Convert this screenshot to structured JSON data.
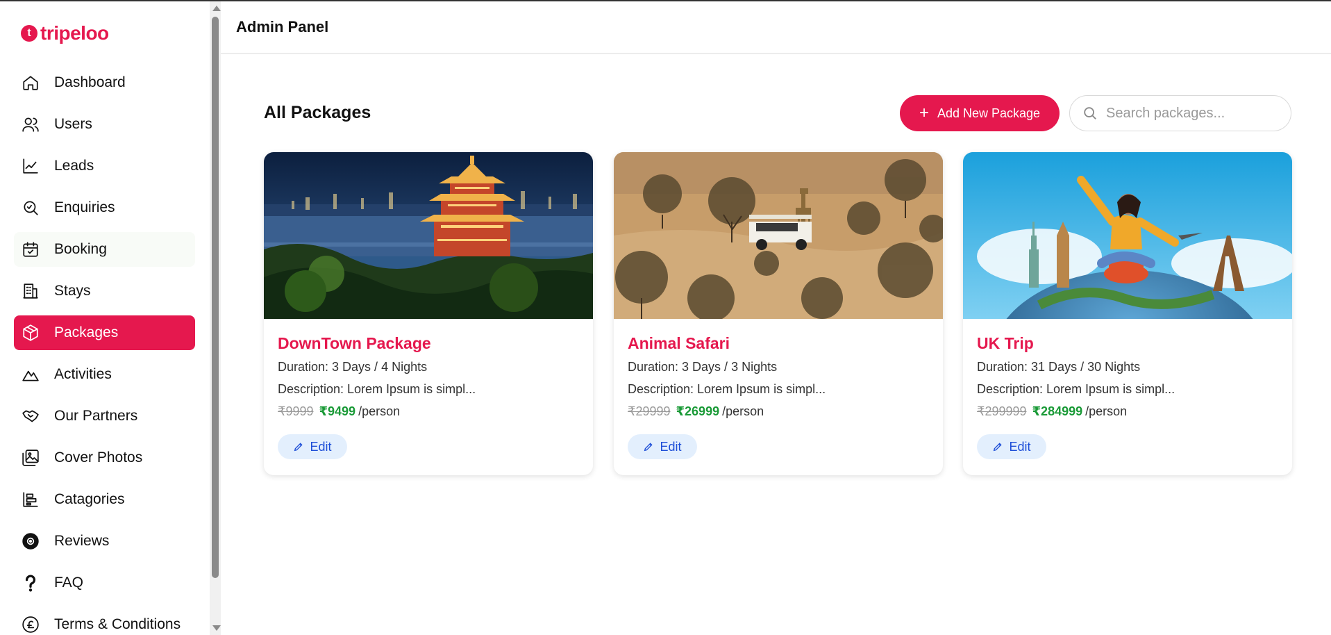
{
  "brand": {
    "logo_text": "tripeloo",
    "logo_mark": "t",
    "accent_color": "#e5184e"
  },
  "header": {
    "title": "Admin Panel"
  },
  "sidebar": {
    "items": [
      {
        "label": "Dashboard",
        "icon": "home-icon"
      },
      {
        "label": "Users",
        "icon": "users-icon"
      },
      {
        "label": "Leads",
        "icon": "trending-up-icon"
      },
      {
        "label": "Enquiries",
        "icon": "search-icon"
      },
      {
        "label": "Booking",
        "icon": "calendar-check-icon"
      },
      {
        "label": "Stays",
        "icon": "building-icon"
      },
      {
        "label": "Packages",
        "icon": "package-icon",
        "active": true
      },
      {
        "label": "Activities",
        "icon": "mountain-icon"
      },
      {
        "label": "Our Partners",
        "icon": "handshake-icon"
      },
      {
        "label": "Cover Photos",
        "icon": "gallery-icon"
      },
      {
        "label": "Catagories",
        "icon": "category-icon"
      },
      {
        "label": "Reviews",
        "icon": "review-icon"
      },
      {
        "label": "FAQ",
        "icon": "question-icon"
      },
      {
        "label": "Terms & Conditions",
        "icon": "pound-icon"
      }
    ]
  },
  "main": {
    "section_title": "All Packages",
    "add_button_label": "Add New Package",
    "search_placeholder": "Search packages..."
  },
  "packages": [
    {
      "title": "DownTown Package",
      "duration": "Duration: 3 Days / 4 Nights",
      "description": "Description: Lorem Ipsum is simpl...",
      "price_old": "₹9999",
      "price_new": "₹9499",
      "price_unit": "/person",
      "edit_label": "Edit"
    },
    {
      "title": "Animal Safari",
      "duration": "Duration: 3 Days / 3 Nights",
      "description": "Description: Lorem Ipsum is simpl...",
      "price_old": "₹29999",
      "price_new": "₹26999",
      "price_unit": "/person",
      "edit_label": "Edit"
    },
    {
      "title": "UK Trip",
      "duration": "Duration: 31 Days / 30 Nights",
      "description": "Description: Lorem Ipsum is simpl...",
      "price_old": "₹299999",
      "price_new": "₹284999",
      "price_unit": "/person",
      "edit_label": "Edit"
    }
  ]
}
